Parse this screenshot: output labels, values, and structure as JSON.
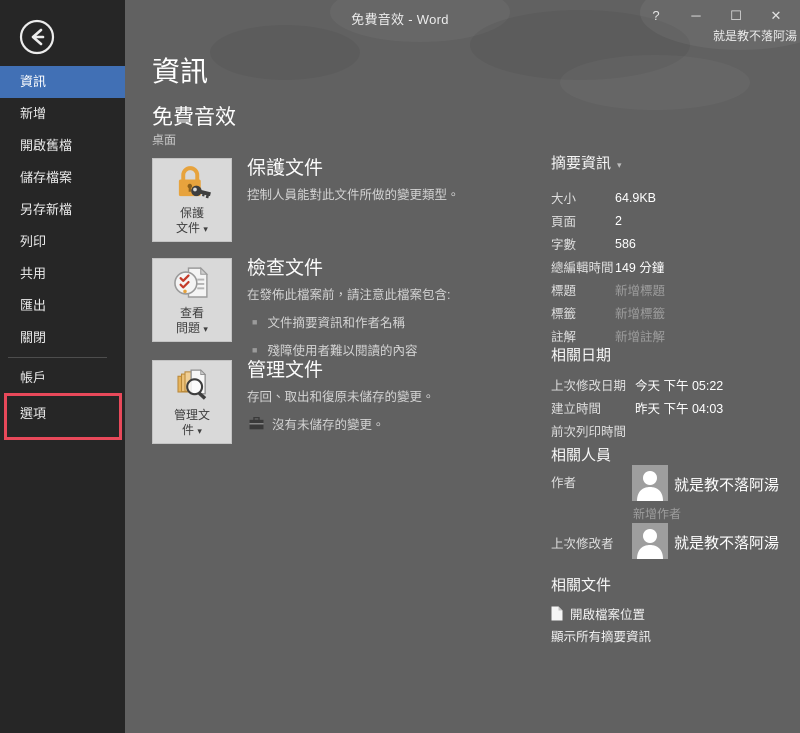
{
  "window": {
    "title": "免費音效 - Word",
    "user": "就是教不落阿湯",
    "controls": {
      "help": "?",
      "minimize": "─",
      "maximize": "☐",
      "close": "✕"
    }
  },
  "icons": {
    "dropdown_caret": "▾",
    "bullet": "■"
  },
  "colors": {
    "sidebar_bg": "#262626",
    "main_bg": "#616161",
    "accent_blue": "#4170b5",
    "highlight_red": "#e8495a",
    "button_bg": "#d9d9d9",
    "gold": "#e7a33d"
  },
  "sidebar": {
    "items": [
      {
        "label": "資訊",
        "selected": true
      },
      {
        "label": "新增"
      },
      {
        "label": "開啟舊檔"
      },
      {
        "label": "儲存檔案"
      },
      {
        "label": "另存新檔"
      },
      {
        "label": "列印"
      },
      {
        "label": "共用"
      },
      {
        "label": "匯出"
      },
      {
        "label": "關閉"
      }
    ],
    "footer_items": [
      {
        "label": "帳戶"
      },
      {
        "label": "選項",
        "highlighted": true
      }
    ]
  },
  "main": {
    "page_title": "資訊",
    "doc_title": "免費音效",
    "doc_location": "桌面",
    "sections": [
      {
        "button_line1": "保護",
        "button_line2": "文件",
        "heading": "保護文件",
        "description": "控制人員能對此文件所做的變更類型。"
      },
      {
        "button_line1": "查看",
        "button_line2": "問題",
        "heading": "檢查文件",
        "description": "在發佈此檔案前，請注意此檔案包含:",
        "bullets": [
          "文件摘要資訊和作者名稱",
          "殘障使用者難以閱讀的內容"
        ]
      },
      {
        "button_line1": "管理文",
        "button_line2": "件",
        "heading": "管理文件",
        "description": "存回、取出和復原未儲存的變更。",
        "item": "沒有未儲存的變更。"
      }
    ]
  },
  "properties": {
    "header": "摘要資訊",
    "rows": [
      {
        "label": "大小",
        "value": "64.9KB"
      },
      {
        "label": "頁面",
        "value": "2"
      },
      {
        "label": "字數",
        "value": "586"
      },
      {
        "label": "總編輯時間",
        "value": "149 分鐘"
      },
      {
        "label": "標題",
        "value": "新增標題"
      },
      {
        "label": "標籤",
        "value": "新增標籤"
      },
      {
        "label": "註解",
        "value": "新增註解"
      }
    ]
  },
  "dates": {
    "header": "相關日期",
    "rows": [
      {
        "label": "上次修改日期",
        "value": "今天 下午 05:22"
      },
      {
        "label": "建立時間",
        "value": "昨天 下午 04:03"
      },
      {
        "label": "前次列印時間",
        "value": ""
      }
    ]
  },
  "people": {
    "header": "相關人員",
    "author_label": "作者",
    "author_name": "就是教不落阿湯",
    "add_author": "新增作者",
    "modifier_label": "上次修改者",
    "modifier_name": "就是教不落阿湯"
  },
  "documents": {
    "header": "相關文件",
    "open_location": "開啟檔案位置",
    "show_all": "顯示所有摘要資訊"
  }
}
